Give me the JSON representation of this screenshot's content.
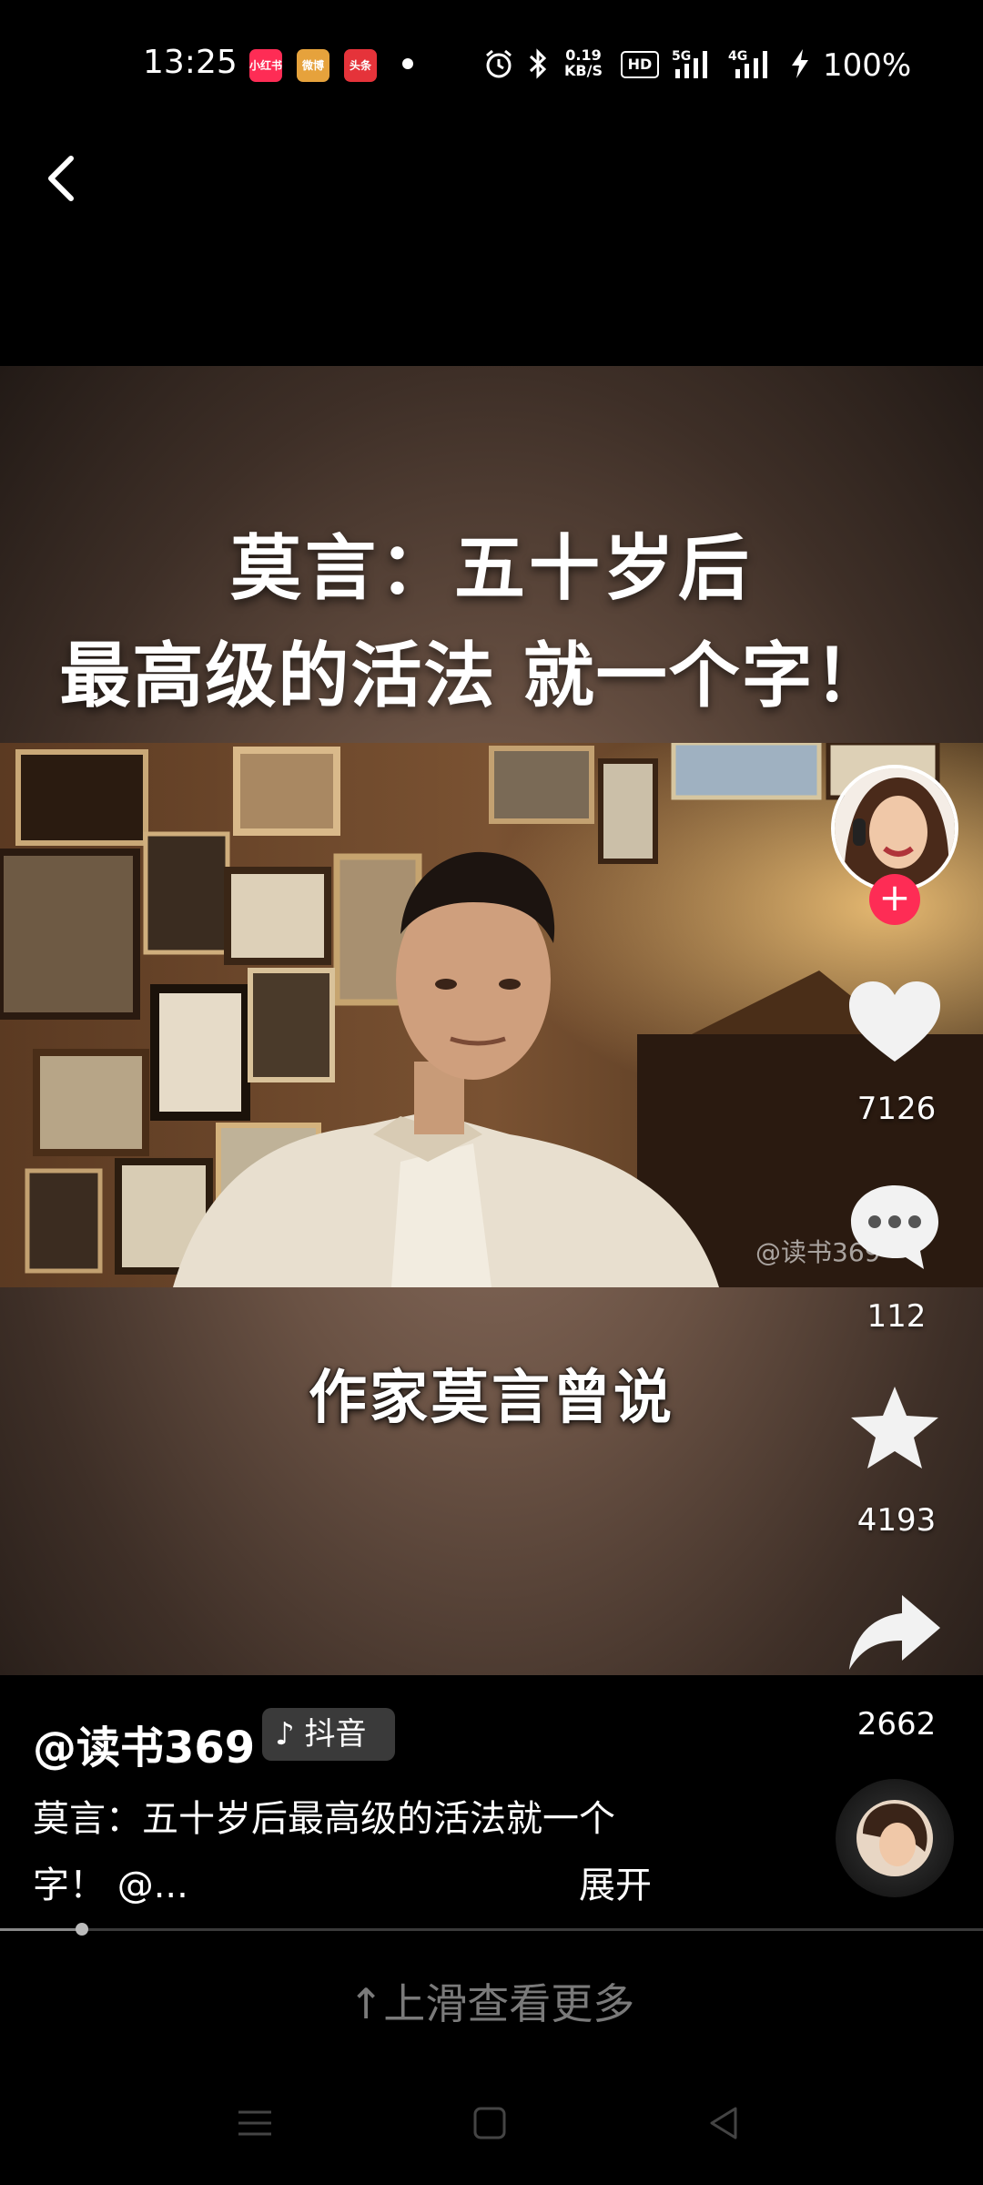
{
  "status_bar": {
    "time": "13:25",
    "apps": [
      {
        "label": "小红书",
        "color": "#fe2c55"
      },
      {
        "label": "微博",
        "color": "#e6a23c"
      },
      {
        "label": "头条",
        "color": "#e5333a"
      }
    ],
    "net_speed_value": "0.19",
    "net_speed_unit": "KB/S",
    "hd": "HD",
    "network_5g": "5G",
    "network_4g": "4G",
    "battery": "100%"
  },
  "video": {
    "title_line1": "莫言：五十岁后",
    "title_line2": "最高级的活法 就一个字！",
    "caption": "作家莫言曾说",
    "watermark": "@读书369"
  },
  "actions": {
    "like_count": "7126",
    "comment_count": "112",
    "favorite_count": "4193",
    "share_count": "2662",
    "follow_symbol": "+"
  },
  "post": {
    "author": "@读书369",
    "platform": "抖音",
    "description_line1": "莫言：五十岁后最高级的活法就一个",
    "description_line2": "字！ @...",
    "expand_label": "展开",
    "progress": 0.083
  },
  "swipe_hint": "↑上滑查看更多",
  "colors": {
    "accent": "#fe2c55",
    "background": "#000000",
    "hint": "#7a7a7a"
  }
}
